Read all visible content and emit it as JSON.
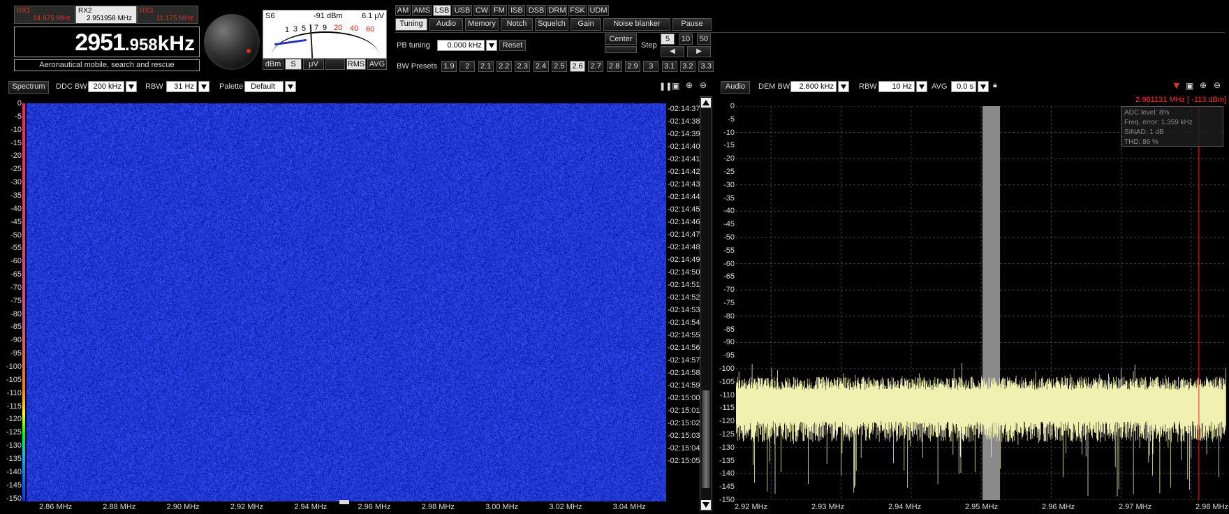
{
  "rx_tabs": [
    {
      "name": "RX1",
      "freq": "14.975 MHz",
      "active": false
    },
    {
      "name": "RX2",
      "freq": "2.951958 MHz",
      "active": true
    },
    {
      "name": "RX3",
      "freq": "11.175 MHz",
      "active": false
    }
  ],
  "frequency": {
    "main": "2951",
    "fraction": ".958",
    "unit": "kHz"
  },
  "service": "Aeronautical mobile, search and rescue",
  "smeter": {
    "s_label": "S6",
    "dbm": "-91 dBm",
    "uv": "6.1 μV",
    "scale": [
      "1",
      "3",
      "5",
      "7",
      "9",
      "20",
      "40",
      "60"
    ],
    "mode_buttons": [
      "dBm",
      "S",
      "μV",
      "",
      "RMS",
      "AVG"
    ]
  },
  "modes": [
    "AM",
    "AMS",
    "LSB",
    "USB",
    "CW",
    "FM",
    "ISB",
    "DSB",
    "DRM",
    "FSK",
    "UDM"
  ],
  "active_mode": "LSB",
  "tabs": [
    "Tuning",
    "Audio",
    "Memory",
    "Notch",
    "Squelch",
    "Gain",
    "Noise blanker",
    "Pause"
  ],
  "tuning": {
    "pb_label": "PB tuning",
    "pb_value": "0.000 kHz",
    "reset": "Reset",
    "center": "Center",
    "step_label": "Step",
    "steps": [
      "5",
      "10",
      "50"
    ],
    "bw_label": "BW Presets",
    "bw_presets": [
      "1.9",
      "2",
      "2.1",
      "2.2",
      "2.3",
      "2.4",
      "2.5",
      "2.6",
      "2.7",
      "2.8",
      "2.9",
      "3",
      "3.1",
      "3.2",
      "3.3"
    ],
    "bw_active": "2.6"
  },
  "spectrum_header": {
    "title": "Spectrum",
    "ddc_label": "DDC BW",
    "ddc_value": "200 kHz",
    "rbw_label": "RBW",
    "rbw_value": "31 Hz",
    "palette_label": "Palette",
    "palette_value": "Default"
  },
  "audio_header": {
    "title": "Audio",
    "dem_label": "DEM BW",
    "dem_value": "2.600 kHz",
    "rbw_label": "RBW",
    "rbw_value": "10 Hz",
    "avg_label": "AVG",
    "avg_value": "0.0 s"
  },
  "db_scale": [
    "0",
    "-5",
    "-10",
    "-15",
    "-20",
    "-25",
    "-30",
    "-35",
    "-40",
    "-45",
    "-50",
    "-55",
    "-60",
    "-65",
    "-70",
    "-75",
    "-80",
    "-85",
    "-90",
    "-95",
    "-100",
    "-105",
    "-110",
    "-115",
    "-120",
    "-125",
    "-130",
    "-135",
    "-140",
    "-145",
    "-150"
  ],
  "timestamps": [
    "02:14:37",
    "02:14:38",
    "02:14:39",
    "02:14:40",
    "02:14:41",
    "02:14:42",
    "02:14:43",
    "02:14:44",
    "02:14:45",
    "02:14:46",
    "02:14:47",
    "02:14:48",
    "02:14:49",
    "02:14:50",
    "02:14:51",
    "02:14:52",
    "02:14:53",
    "02:14:54",
    "02:14:55",
    "02:14:56",
    "02:14:57",
    "02:14:58",
    "02:14:59",
    "02:15:00",
    "02:15:01",
    "02:15:02",
    "02:15:03",
    "02:15:04",
    "02:15:05"
  ],
  "waterfall_x": [
    "2.86 MHz",
    "2.88 MHz",
    "2.90 MHz",
    "2.92 MHz",
    "2.94 MHz",
    "2.96 MHz",
    "2.98 MHz",
    "3.00 MHz",
    "3.02 MHz",
    "3.04 MHz"
  ],
  "audio_x": [
    "2.92 MHz",
    "2.93 MHz",
    "2.94 MHz",
    "2.95 MHz",
    "2.96 MHz",
    "2.97 MHz",
    "2.98 MHz"
  ],
  "marker": "2.981131 MHz [ -113 dBm]",
  "info": [
    "ADC level: 8%",
    "Freq. error: 1.359 kHz",
    "SINAD: 1 dB",
    "THD: 86 %"
  ],
  "chart_data": {
    "type": "line",
    "x": [
      2.915,
      2.92,
      2.93,
      2.94,
      2.95,
      2.96,
      2.97,
      2.98,
      2.985
    ],
    "series": [
      {
        "values": [
          -115,
          -115,
          -115,
          -115,
          -115,
          -115,
          -115,
          -115,
          -115
        ]
      }
    ],
    "xlabel": "",
    "ylabel": "",
    "ylim": [
      -150,
      0
    ],
    "xlim": [
      2.915,
      2.985
    ],
    "x_ticks": [
      "2.92 MHz",
      "2.93 MHz",
      "2.94 MHz",
      "2.95 MHz",
      "2.96 MHz",
      "2.97 MHz",
      "2.98 MHz"
    ],
    "grid": true
  },
  "colors": {
    "accent_red": "#e03020",
    "trace": "#f0f0b0",
    "waterfall": "#1a2fd8"
  }
}
